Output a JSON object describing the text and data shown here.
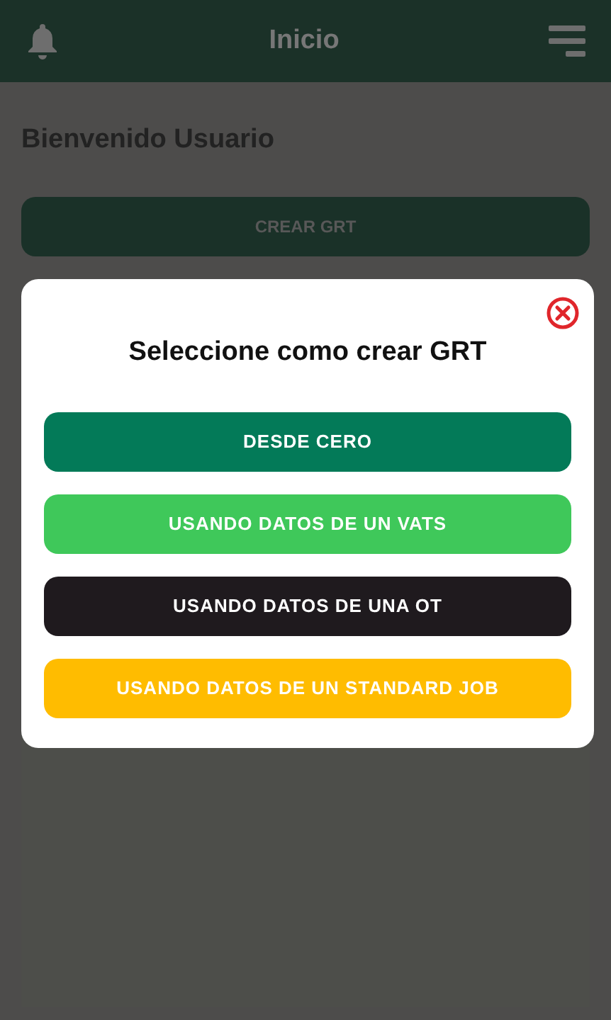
{
  "header": {
    "title": "Inicio"
  },
  "welcome": "Bienvenido Usuario",
  "create_button": "CREAR GRT",
  "dialog": {
    "title": "Seleccione como crear GRT",
    "options": [
      {
        "label": "DESDE CERO",
        "color": "#037a58"
      },
      {
        "label": "USANDO DATOS DE UN VATS",
        "color": "#3fc85a"
      },
      {
        "label": "USANDO DATOS DE UNA OT",
        "color": "#1f1a1e"
      },
      {
        "label": "USANDO DATOS DE UN STANDARD JOB",
        "color": "#ffbc00"
      }
    ]
  }
}
